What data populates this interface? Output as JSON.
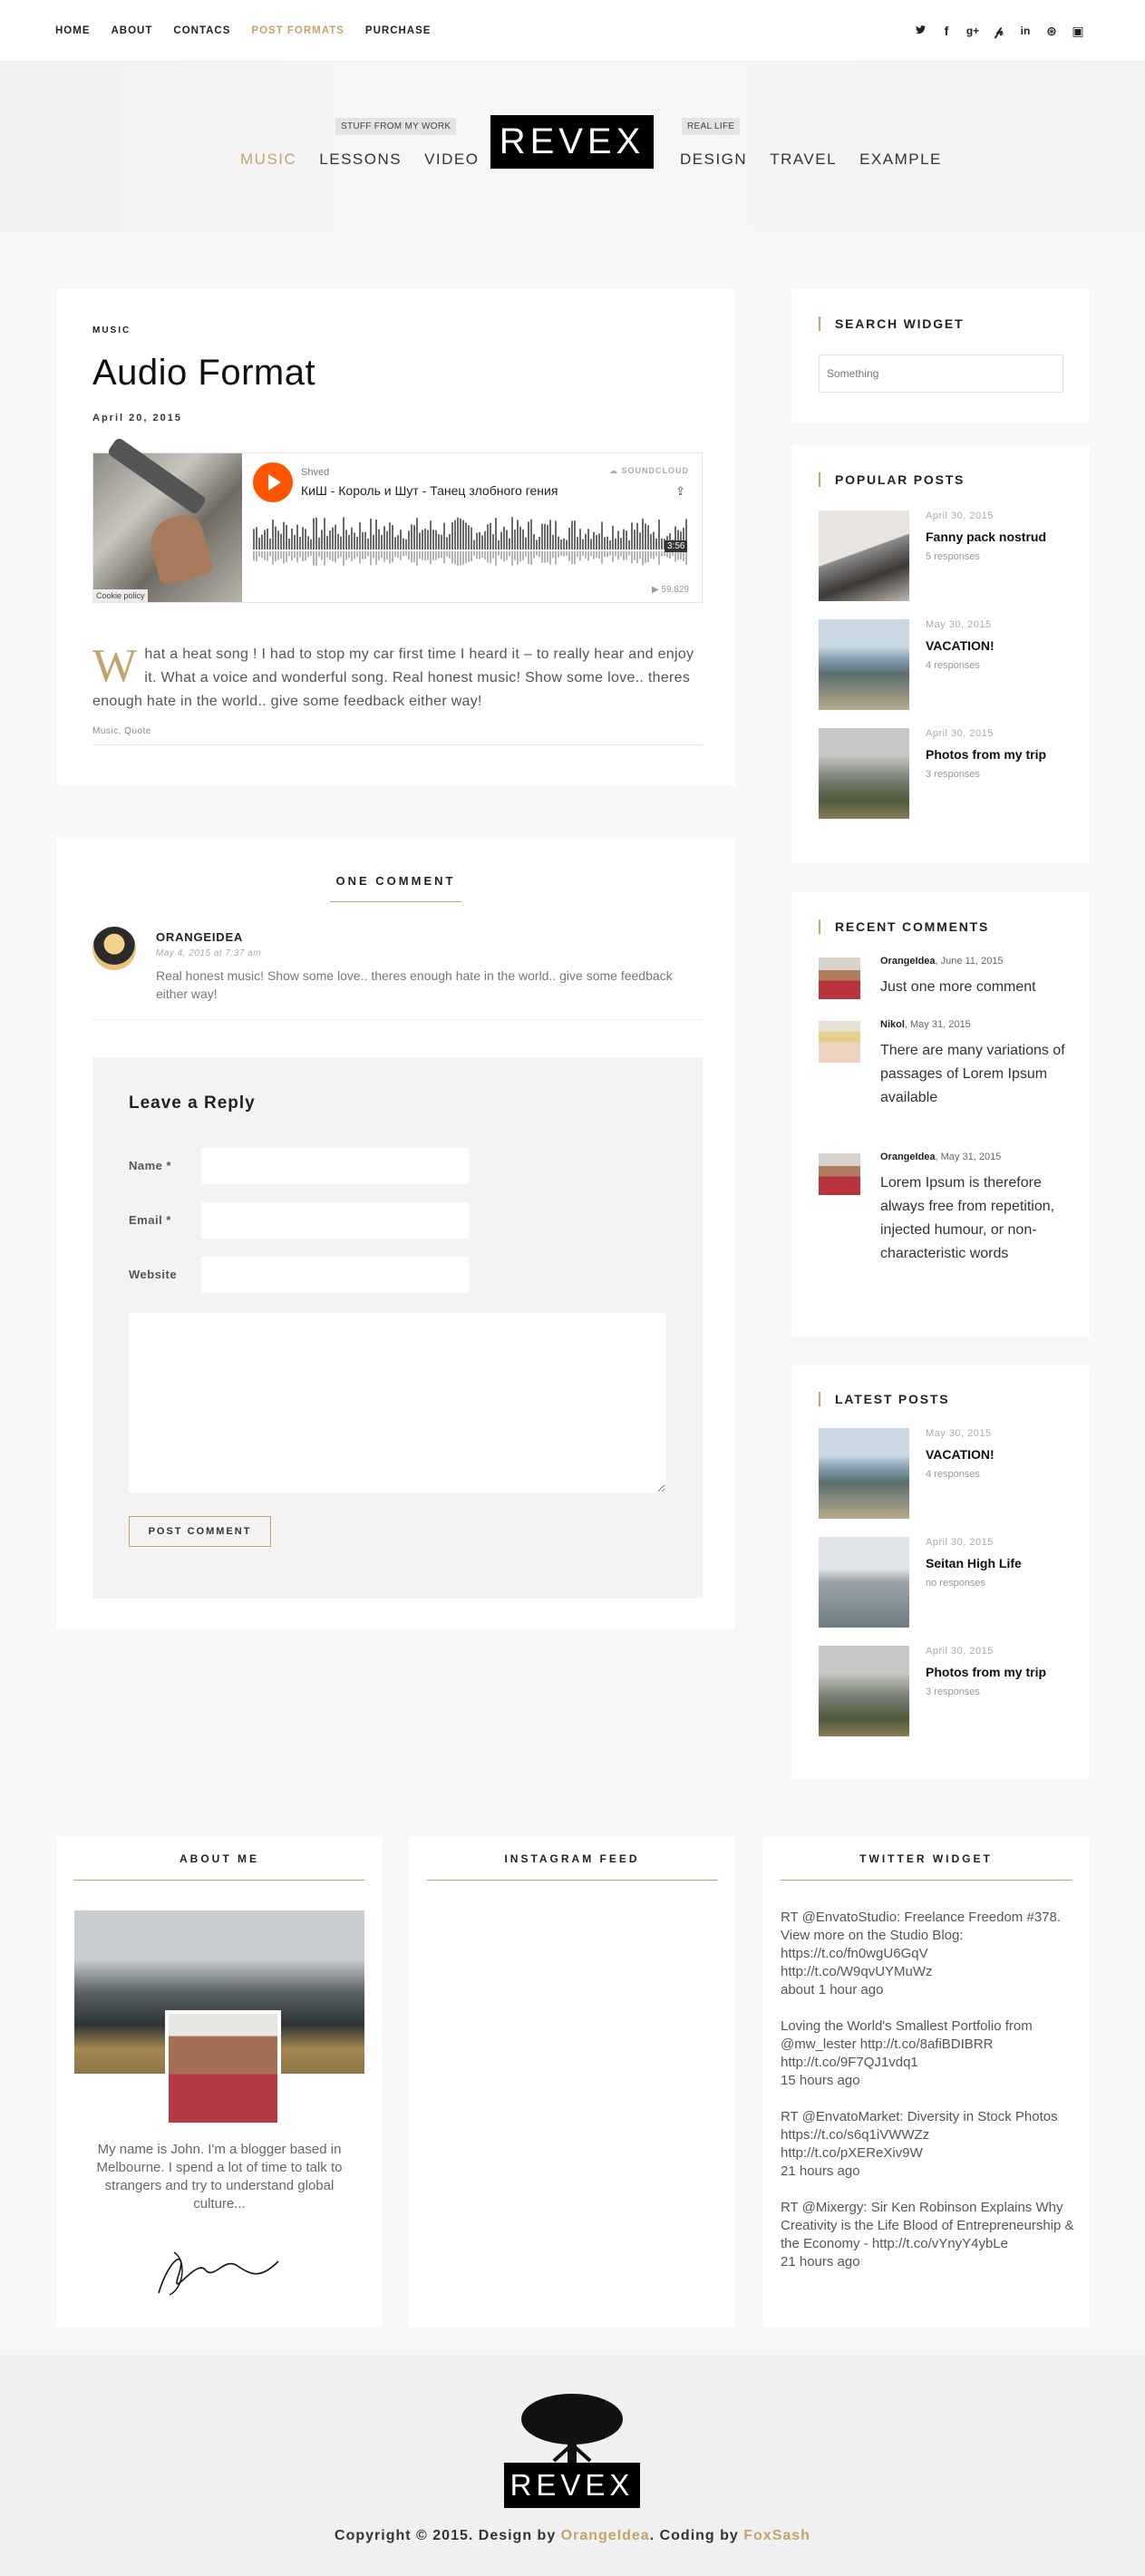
{
  "topnav": {
    "items": [
      "HOME",
      "ABOUT",
      "CONTACS",
      "POST FORMATS",
      "PURCHASE"
    ],
    "active": "POST FORMATS"
  },
  "social_icons": [
    "twitter-icon",
    "facebook-icon",
    "google-plus-icon",
    "pinterest-icon",
    "linkedin-icon",
    "dribbble-icon",
    "youtube-icon"
  ],
  "header": {
    "logo": "REVEX",
    "left_nav": [
      "MUSIC",
      "LESSONS",
      "VIDEO"
    ],
    "right_nav": [
      "DESIGN",
      "TRAVEL",
      "EXAMPLE"
    ],
    "tag_left": "STUFF FROM MY WORK",
    "tag_right": "REAL LIFE"
  },
  "post": {
    "category": "MUSIC",
    "title": "Audio Format",
    "date": "April 20, 2015",
    "player": {
      "user": "Shved",
      "track": "КиШ - Король и Шут - Танец злобного гения",
      "brand": "SOUNDCLOUD",
      "duration": "3:56",
      "plays": "▶ 59,829",
      "cookie": "Cookie policy"
    },
    "dropcap": "W",
    "excerpt": "hat a heat song ! I had to stop my car first time I heard it – to really hear and enjoy it. What a voice and wonderful song. Real honest music! Show some love.. theres enough hate in the world.. give some feedback either way!",
    "tags": "Music, Quote"
  },
  "comments": {
    "title": "ONE COMMENT",
    "author": "ORANGEIDEA",
    "date": "May 4, 2015 at 7:37 am",
    "text": "Real honest music! Show some love.. theres enough hate in the world.. give some feedback either way!"
  },
  "reply": {
    "title": "Leave a Reply",
    "name_label": "Name *",
    "email_label": "Email *",
    "website_label": "Website",
    "submit": "POST COMMENT"
  },
  "sidebar": {
    "search": {
      "title": "SEARCH WIDGET",
      "placeholder": "Something"
    },
    "popular": {
      "title": "POPULAR POSTS",
      "items": [
        {
          "date": "April 30, 2015",
          "title": "Fanny pack nostrud",
          "responses": "5 responses"
        },
        {
          "date": "May 30, 2015",
          "title": "VACATION!",
          "responses": "4 responses"
        },
        {
          "date": "April 30, 2015",
          "title": "Photos from my trip",
          "responses": "3 responses"
        }
      ]
    },
    "recent_comments": {
      "title": "RECENT COMMENTS",
      "items": [
        {
          "author": "OrangeIdea",
          "date": ", June 11, 2015",
          "text": "Just one more comment"
        },
        {
          "author": "Nikol",
          "date": ", May 31, 2015",
          "text": "There are many variations of passages of Lorem Ipsum available"
        },
        {
          "author": "OrangeIdea",
          "date": ", May 31, 2015",
          "text": "Lorem Ipsum is therefore always free from repetition, injected humour, or non-characteristic words"
        }
      ]
    },
    "latest": {
      "title": "LATEST POSTS",
      "items": [
        {
          "date": "May 30, 2015",
          "title": "VACATION!",
          "responses": "4 responses"
        },
        {
          "date": "April 30, 2015",
          "title": "Seitan High Life",
          "responses": "no responses"
        },
        {
          "date": "April 30, 2015",
          "title": "Photos from my trip",
          "responses": "3 responses"
        }
      ]
    }
  },
  "bottom": {
    "about": {
      "title": "ABOUT ME",
      "text": "My name is John. I'm a blogger based in Melbourne. I spend a lot of time to talk to strangers and try to understand global culture..."
    },
    "instagram": {
      "title": "INSTAGRAM FEED"
    },
    "twitter": {
      "title": "TWITTER WIDGET",
      "tweets": [
        {
          "text": "RT @EnvatoStudio: Freelance Freedom #378. View more on the Studio Blog: https://t.co/fn0wgU6GqV http://t.co/W9qvUYMuWz",
          "time": "about 1 hour ago"
        },
        {
          "text": "Loving the World's Smallest Portfolio from @mw_lester http://t.co/8afiBDIBRR http://t.co/9F7QJ1vdq1",
          "time": "15 hours ago"
        },
        {
          "text": "RT @EnvatoMarket: Diversity in Stock Photos https://t.co/s6q1iVWWZz http://t.co/pXEReXiv9W",
          "time": "21 hours ago"
        },
        {
          "text": "RT @Mixergy: Sir Ken Robinson Explains Why Creativity is the Life Blood of Entrepreneurship & the Economy - http://t.co/vYnyY4ybLe",
          "time": "21 hours ago"
        }
      ]
    }
  },
  "footer": {
    "logo": "REVEX",
    "copy_prefix": "Copyright © 2015. Design by ",
    "designer": "OrangeIdea",
    "coding_prefix": ". Coding by ",
    "coder": "FoxSash"
  }
}
